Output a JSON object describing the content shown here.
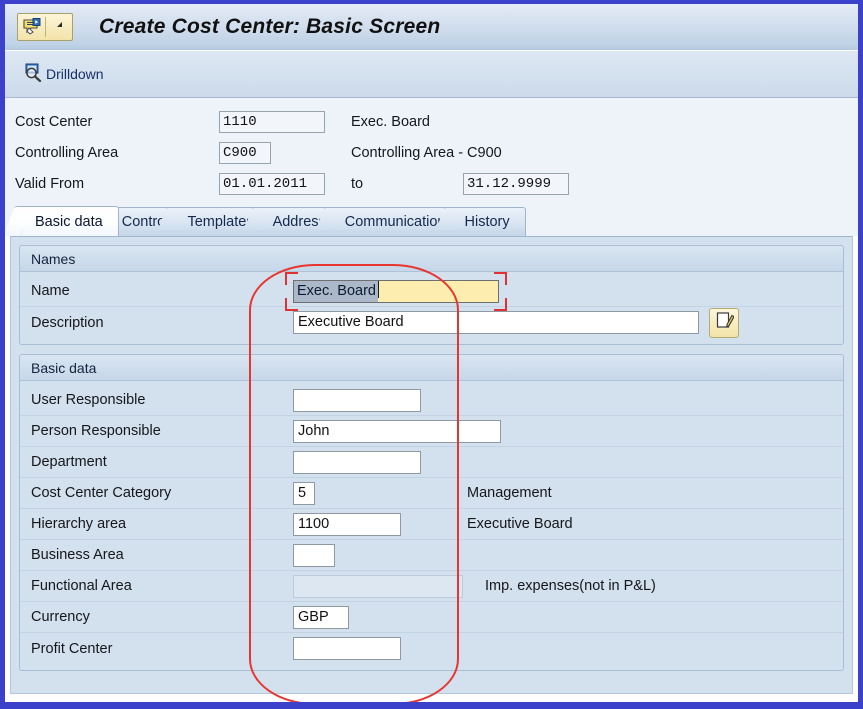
{
  "window": {
    "title": "Create Cost Center: Basic Screen",
    "icon": "sap-menu-icon",
    "dropdown_icon": "caret-down-icon",
    "border_color": "#3b41cb"
  },
  "toolbar": {
    "items": [
      {
        "label": "Drilldown",
        "icon": "drilldown-magnifier-icon"
      }
    ]
  },
  "header": {
    "rows": [
      {
        "label": "Cost Center",
        "value": "1110",
        "side": "Exec. Board"
      },
      {
        "label": "Controlling Area",
        "value": "C900",
        "side": "Controlling Area - C900"
      },
      {
        "label": "Valid From",
        "value": "01.01.2011",
        "to_label": "to",
        "to_value": "31.12.9999"
      }
    ]
  },
  "tabs": [
    {
      "label": "Basic data",
      "active": true
    },
    {
      "label": "Control",
      "active": false
    },
    {
      "label": "Templates",
      "active": false
    },
    {
      "label": "Address",
      "active": false
    },
    {
      "label": "Communication",
      "active": false
    },
    {
      "label": "History",
      "active": false
    }
  ],
  "names_section": {
    "title": "Names",
    "fields": [
      {
        "label": "Name",
        "value": "Exec. Board",
        "state": "focused-selected",
        "highlight_color": "#fdeeb0",
        "selection_color": "#aab8c9"
      },
      {
        "label": "Description",
        "value": "Executive Board",
        "state": "editable",
        "edit_icon": "note-pencil-icon"
      }
    ]
  },
  "basic_data_section": {
    "title": "Basic data",
    "fields": [
      {
        "label": "User Responsible",
        "value": "",
        "side": "",
        "state": "editable"
      },
      {
        "label": "Person Responsible",
        "value": "John",
        "side": "",
        "state": "editable"
      },
      {
        "label": "Department",
        "value": "",
        "side": "",
        "state": "editable"
      },
      {
        "label": "Cost Center Category",
        "value": "5",
        "side": "Management",
        "state": "editable"
      },
      {
        "label": "Hierarchy area",
        "value": "1100",
        "side": "Executive Board",
        "state": "editable"
      },
      {
        "label": "Business Area",
        "value": "",
        "side": "",
        "state": "editable"
      },
      {
        "label": "Functional Area",
        "value": "",
        "side": "Imp. expenses(not in P&L)",
        "state": "disabled"
      },
      {
        "label": "Currency",
        "value": "GBP",
        "side": "",
        "state": "editable"
      },
      {
        "label": "Profit Center",
        "value": "",
        "side": "",
        "state": "editable"
      }
    ]
  },
  "annotation": {
    "type": "red-oval-highlight",
    "color": "#e8352f"
  }
}
